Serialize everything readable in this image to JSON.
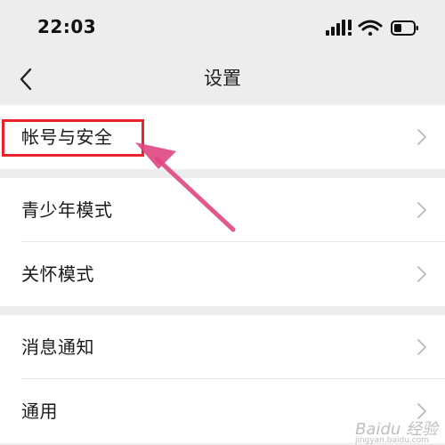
{
  "status_bar": {
    "time": "22:03"
  },
  "nav": {
    "title": "设置"
  },
  "groups": [
    {
      "items": [
        {
          "label": "帐号与安全"
        }
      ]
    },
    {
      "items": [
        {
          "label": "青少年模式"
        },
        {
          "label": "关怀模式"
        }
      ]
    },
    {
      "items": [
        {
          "label": "消息通知"
        },
        {
          "label": "通用"
        }
      ]
    }
  ],
  "annotation": {
    "highlight_color": "#e8232b",
    "arrow_color": "#e0467f"
  },
  "watermark": {
    "text": "Baidu 经验",
    "sub": "jingyan.baidu.com"
  }
}
